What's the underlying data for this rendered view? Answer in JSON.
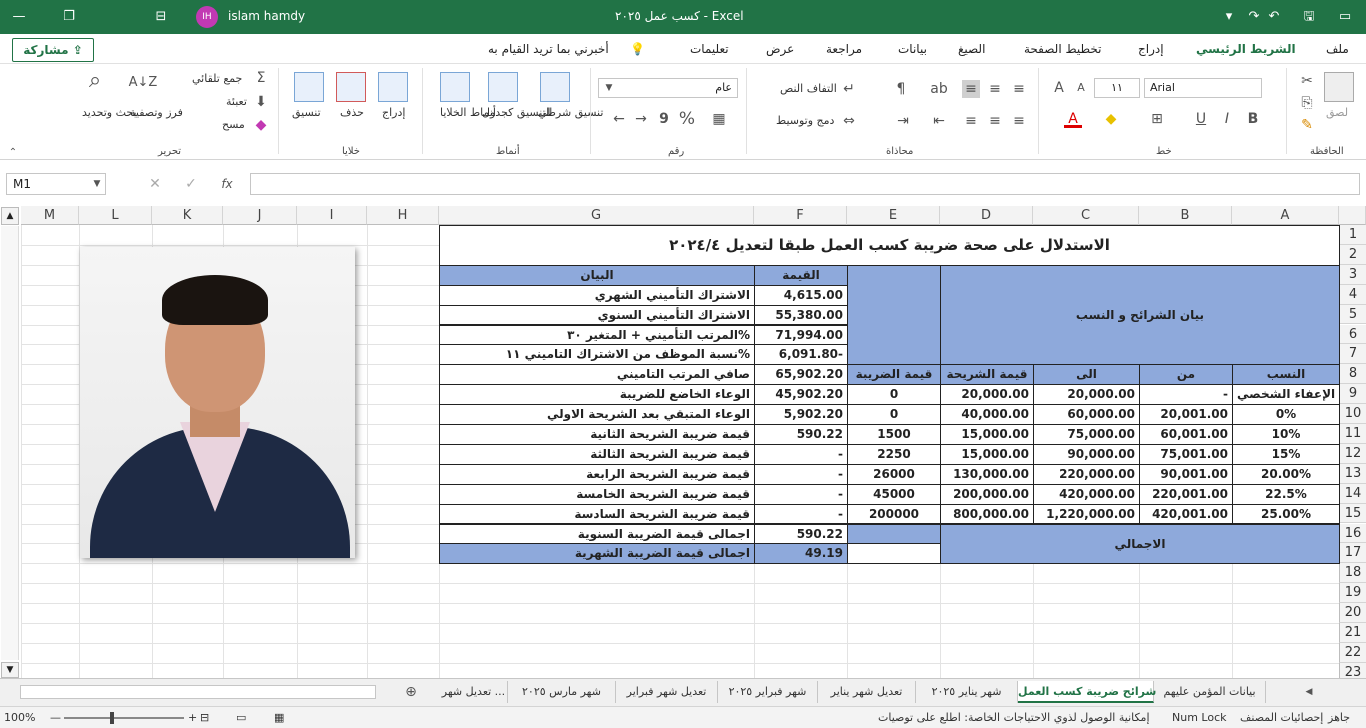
{
  "titlebar": {
    "doc_title": "كسب عمل ٢٠٢٥ - Excel",
    "user_name": "islam hamdy",
    "user_initials": "IH",
    "accent": "#217346"
  },
  "menu": {
    "file": "ملف",
    "home": "الشريط الرئيسي",
    "insert": "إدراج",
    "page_layout": "تخطيط الصفحة",
    "formulas": "الصيغ",
    "data": "بيانات",
    "review": "مراجعة",
    "view": "عرض",
    "help": "تعليمات",
    "tell_me": "أخبرني بما تريد القيام به",
    "share": "مشاركة"
  },
  "ribbon": {
    "clipboard": {
      "paste": "لصق",
      "group": "الحافظة"
    },
    "font": {
      "name": "Arial",
      "size": "١١",
      "group": "خط"
    },
    "alignment": {
      "wrap": "التفاف النص",
      "merge": "دمج وتوسيط",
      "group": "محاذاة"
    },
    "number": {
      "format": "عام",
      "group": "رقم"
    },
    "styles": {
      "conditional": "تنسيق شرطي",
      "as_table": "التنسيق كجدول",
      "cell_styles": "أنماط الخلايا",
      "group": "أنماط"
    },
    "cells": {
      "insert": "إدراج",
      "delete": "حذف",
      "format": "تنسيق",
      "group": "خلايا"
    },
    "editing": {
      "autosum": "جمع تلقائي",
      "fill": "تعبئة",
      "clear": "مسح",
      "sort": "فرز وتصفية",
      "find": "بحث وتحديد",
      "group": "تحرير"
    }
  },
  "formula_bar": {
    "name_box": "M1",
    "fx": "fx",
    "formula": ""
  },
  "columns": [
    "A",
    "B",
    "C",
    "D",
    "E",
    "F",
    "G",
    "H",
    "I",
    "J",
    "K",
    "L",
    "M"
  ],
  "rows": [
    "1",
    "2",
    "3",
    "4",
    "5",
    "6",
    "7",
    "8",
    "9",
    "10",
    "11",
    "12",
    "13",
    "14",
    "15",
    "16",
    "17",
    "18",
    "19",
    "20",
    "21",
    "22",
    "23"
  ],
  "sheet": {
    "title": "الاستدلال على صحة ضريبة كسب العمل طبقا لتعديل ٢٠٢٤/٤",
    "brackets_header": "بيان الشرائح و النسب",
    "bracket_cols": [
      "النسب",
      "من",
      "الى",
      "قيمة الشريحة",
      "قيمة الضريبة"
    ],
    "brackets": [
      [
        "الإعفاء الشخصي",
        "-",
        "20,000.00",
        "20,000.00",
        "0"
      ],
      [
        "0%",
        "20,001.00",
        "60,000.00",
        "40,000.00",
        "0"
      ],
      [
        "10%",
        "60,001.00",
        "75,000.00",
        "15,000.00",
        "1500"
      ],
      [
        "15%",
        "75,001.00",
        "90,000.00",
        "15,000.00",
        "2250"
      ],
      [
        "20.00%",
        "90,001.00",
        "220,000.00",
        "130,000.00",
        "26000"
      ],
      [
        "22.5%",
        "220,001.00",
        "420,000.00",
        "200,000.00",
        "45000"
      ],
      [
        "25.00%",
        "420,001.00",
        "1,220,000.00",
        "800,000.00",
        "200000"
      ]
    ],
    "total_label": "الاجمالي",
    "value_header": "القيمة",
    "desc_header": "البيان",
    "items": [
      [
        "4,615.00",
        "الاشتراك التأميني الشهري"
      ],
      [
        "55,380.00",
        "الاشتراك التأميني السنوي"
      ],
      [
        "71,994.00",
        "المرتب التأميني + المتغير ٣٠%"
      ],
      [
        "6,091.80-",
        "نسبة الموظف من الاشتراك التاميني ١١%"
      ],
      [
        "65,902.20",
        "صافي المرتب التاميني"
      ],
      [
        "45,902.20",
        "الوعاء الخاضع للضريبة"
      ],
      [
        "5,902.20",
        "الوعاء المتبقي بعد الشريحة الاولي"
      ],
      [
        "590.22",
        "قيمة ضريبة الشريحة الثانية"
      ],
      [
        "-",
        "قيمة ضريبة الشريحة الثالثة"
      ],
      [
        "-",
        "قيمة ضريبة الشريحة الرابعة"
      ],
      [
        "-",
        "قيمة ضريبة الشريحة الخامسة"
      ],
      [
        "-",
        "قيمة ضريبة الشريحة السادسة"
      ],
      [
        "590.22",
        "اجمالى قيمة الضريبة السنوية"
      ],
      [
        "49.19",
        "اجمالى قيمة الضريبة الشهرية"
      ]
    ],
    "header_color": "#8ea9db"
  },
  "tabs": [
    "بيانات المؤمن عليهم",
    "شرائح ضريبة كسب العمل",
    "شهر يناير ٢٠٢٥",
    "تعديل شهر يناير",
    "شهر فبراير ٢٠٢٥",
    "تعديل شهر فبراير",
    "شهر مارس ٢٠٢٥",
    "تعديل شهر ..."
  ],
  "status": {
    "ready": "جاهز",
    "stats": "إحصائيات المصنف",
    "num_lock": "Num Lock",
    "accessibility": "إمكانية الوصول لذوي الاحتياجات الخاصة: اطلع على توصيات",
    "zoom": "100%"
  }
}
